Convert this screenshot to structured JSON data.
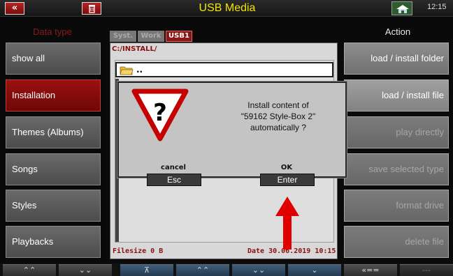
{
  "titlebar": {
    "back_label": "«",
    "title": "USB Media",
    "time": "12:15",
    "back_icon": "double-chevron-left-icon",
    "trash_icon": "trash-icon",
    "home_icon": "home-icon"
  },
  "left_panel": {
    "header": "Data type",
    "items": [
      {
        "label": "show all"
      },
      {
        "label": "Installation"
      },
      {
        "label": "Themes (Albums)"
      },
      {
        "label": "Songs"
      },
      {
        "label": "Styles"
      },
      {
        "label": "Playbacks"
      }
    ],
    "active_index": 1
  },
  "right_panel": {
    "header": "Action",
    "items": [
      {
        "label": "load  /  install folder"
      },
      {
        "label": "load  /  install file"
      },
      {
        "label": "play directly"
      },
      {
        "label": "save selected type"
      },
      {
        "label": "format drive"
      },
      {
        "label": "delete file"
      }
    ]
  },
  "browser": {
    "tabs": [
      "Syst.",
      "Work",
      "USB1"
    ],
    "active_tab": "USB1",
    "path": "C:/INSTALL/",
    "files": [
      {
        "name": "..",
        "icon": "folder-icon"
      }
    ],
    "filesize": "Filesize  0 B",
    "date": "Date  30.06.2019  10:15"
  },
  "dialog": {
    "icon": "question-warning-icon",
    "message_line1": "Install content of",
    "message_line2": "\"59162 Style-Box 2\"",
    "message_line3": "automatically ?",
    "cancel_label": "cancel",
    "cancel_key": "Esc",
    "ok_label": "OK",
    "ok_key": "Enter"
  },
  "bottombar": {
    "buttons": [
      {
        "label": "⌃⌃",
        "icon": "double-chevron-up-icon"
      },
      {
        "label": "⌄⌄",
        "icon": "double-chevron-down-icon"
      },
      {
        "label": "⊼",
        "icon": "scroll-to-top-icon"
      },
      {
        "label": "⌃⌃",
        "icon": "double-chevron-up-icon"
      },
      {
        "label": "⌄⌄",
        "icon": "double-chevron-down-icon"
      },
      {
        "label": "⌄",
        "icon": "chevron-down-icon"
      },
      {
        "label": "«==",
        "icon": "back-arrow-icon"
      },
      {
        "label": "---"
      }
    ]
  },
  "colors": {
    "accent_red": "#8a1616",
    "title_yellow": "#f2e600",
    "annotation_arrow": "#e00000"
  }
}
